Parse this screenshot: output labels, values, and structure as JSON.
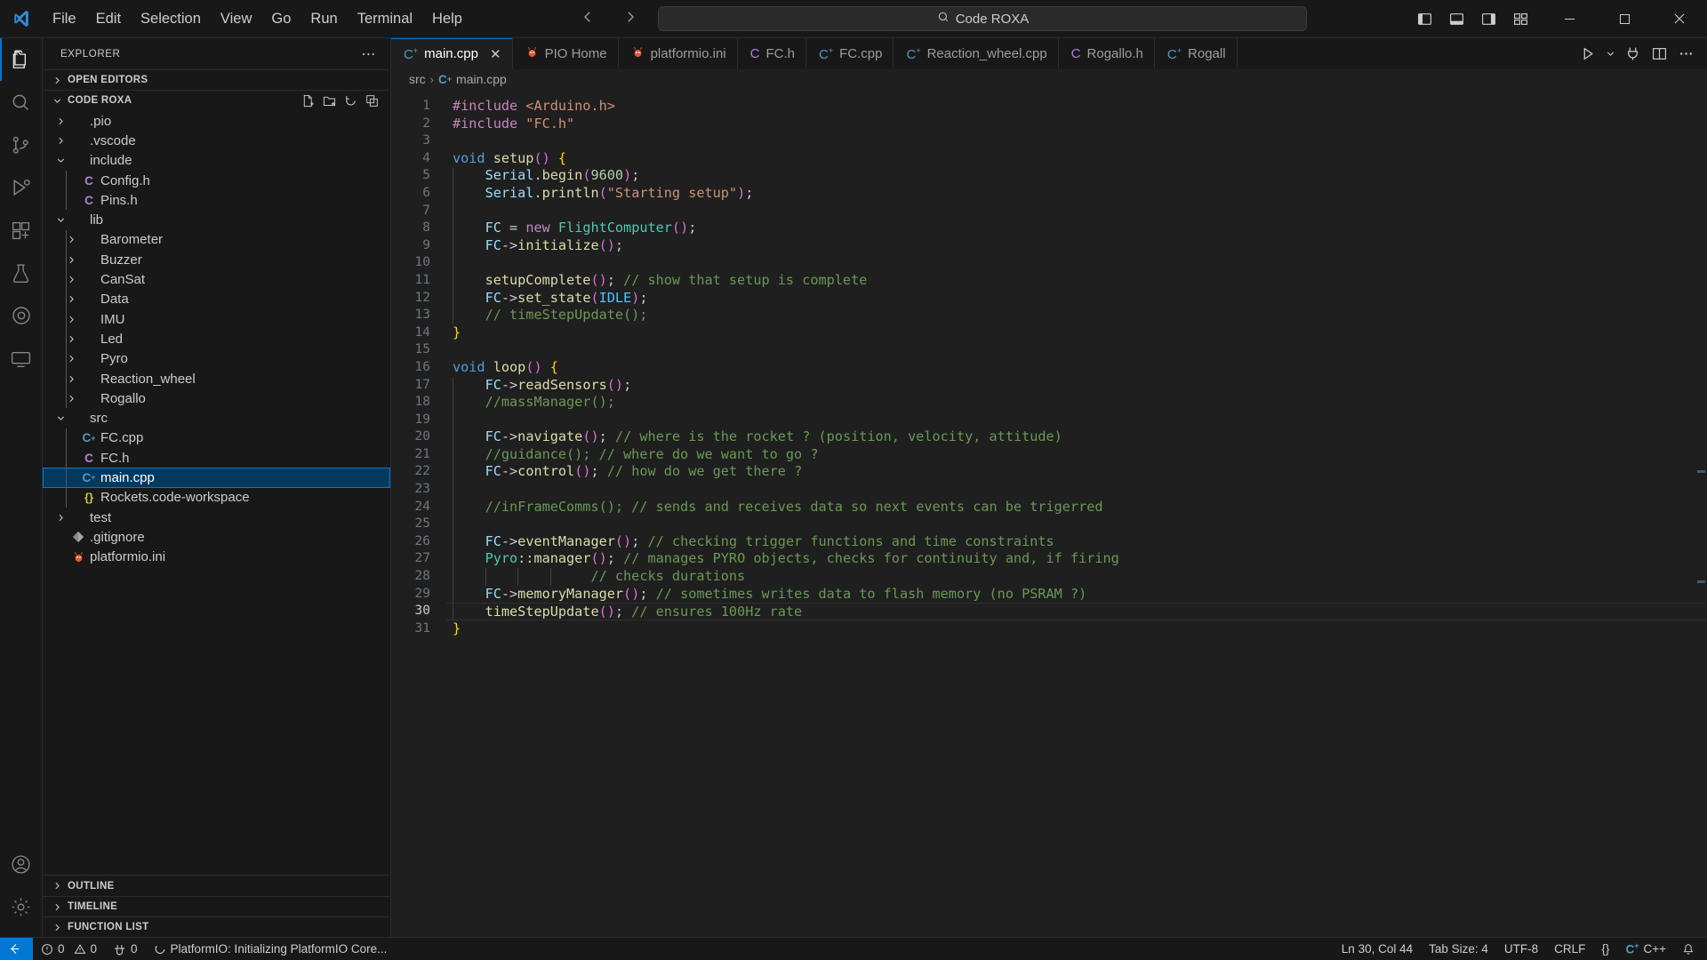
{
  "window": {
    "app": "Visual Studio Code",
    "command_center_text": "Code ROXA",
    "search_icon": "search-icon"
  },
  "menu": {
    "items": [
      {
        "label": "File"
      },
      {
        "label": "Edit"
      },
      {
        "label": "Selection"
      },
      {
        "label": "View"
      },
      {
        "label": "Go"
      },
      {
        "label": "Run"
      },
      {
        "label": "Terminal"
      },
      {
        "label": "Help"
      }
    ]
  },
  "window_controls": {
    "minimize": "─",
    "maximize": "☐",
    "close": "✕"
  },
  "layout_toggles": [
    {
      "name": "toggle-primary-sidebar-icon"
    },
    {
      "name": "toggle-panel-icon"
    },
    {
      "name": "toggle-secondary-sidebar-icon"
    },
    {
      "name": "customize-layout-icon"
    }
  ],
  "activitybar": {
    "items": [
      {
        "name": "explorer",
        "active": true
      },
      {
        "name": "search",
        "active": false
      },
      {
        "name": "source-control",
        "active": false
      },
      {
        "name": "run-and-debug",
        "active": false
      },
      {
        "name": "extensions",
        "active": false
      },
      {
        "name": "testing",
        "active": false
      },
      {
        "name": "platformio",
        "active": false
      },
      {
        "name": "remote-explorer",
        "active": false
      }
    ],
    "bottom": [
      {
        "name": "accounts"
      },
      {
        "name": "manage-settings"
      }
    ]
  },
  "sidebar": {
    "title": "EXPLORER",
    "more_actions": "⋯",
    "sections": [
      {
        "label": "OPEN EDITORS",
        "expanded": false
      },
      {
        "label": "CODE ROXA",
        "expanded": true
      }
    ],
    "folder_actions": [
      {
        "name": "new-file-icon"
      },
      {
        "name": "new-folder-icon"
      },
      {
        "name": "refresh-explorer-icon"
      },
      {
        "name": "collapse-folders-icon"
      }
    ],
    "tree": [
      {
        "label": ".pio",
        "type": "folder",
        "depth": 1,
        "expanded": false
      },
      {
        "label": ".vscode",
        "type": "folder",
        "depth": 1,
        "expanded": false
      },
      {
        "label": "include",
        "type": "folder",
        "depth": 1,
        "expanded": true
      },
      {
        "label": "Config.h",
        "type": "h",
        "depth": 2
      },
      {
        "label": "Pins.h",
        "type": "h",
        "depth": 2
      },
      {
        "label": "lib",
        "type": "folder",
        "depth": 1,
        "expanded": true
      },
      {
        "label": "Barometer",
        "type": "folder",
        "depth": 2,
        "expanded": false
      },
      {
        "label": "Buzzer",
        "type": "folder",
        "depth": 2,
        "expanded": false
      },
      {
        "label": "CanSat",
        "type": "folder",
        "depth": 2,
        "expanded": false
      },
      {
        "label": "Data",
        "type": "folder",
        "depth": 2,
        "expanded": false
      },
      {
        "label": "IMU",
        "type": "folder",
        "depth": 2,
        "expanded": false
      },
      {
        "label": "Led",
        "type": "folder",
        "depth": 2,
        "expanded": false
      },
      {
        "label": "Pyro",
        "type": "folder",
        "depth": 2,
        "expanded": false
      },
      {
        "label": "Reaction_wheel",
        "type": "folder",
        "depth": 2,
        "expanded": false
      },
      {
        "label": "Rogallo",
        "type": "folder",
        "depth": 2,
        "expanded": false
      },
      {
        "label": "src",
        "type": "folder",
        "depth": 1,
        "expanded": true
      },
      {
        "label": "FC.cpp",
        "type": "cpp",
        "depth": 2
      },
      {
        "label": "FC.h",
        "type": "h",
        "depth": 2
      },
      {
        "label": "main.cpp",
        "type": "cpp",
        "depth": 2,
        "selected": true
      },
      {
        "label": "Rockets.code-workspace",
        "type": "json",
        "depth": 2
      },
      {
        "label": "test",
        "type": "folder",
        "depth": 1,
        "expanded": false
      },
      {
        "label": ".gitignore",
        "type": "git",
        "depth": 1
      },
      {
        "label": "platformio.ini",
        "type": "pio",
        "depth": 1
      }
    ],
    "bottom_sections": [
      {
        "label": "OUTLINE"
      },
      {
        "label": "TIMELINE"
      },
      {
        "label": "FUNCTION LIST"
      }
    ]
  },
  "editor": {
    "tabs": [
      {
        "label": "main.cpp",
        "icon": "cpp",
        "active": true,
        "closable": true
      },
      {
        "label": "PIO Home",
        "icon": "pio",
        "active": false
      },
      {
        "label": "platformio.ini",
        "icon": "pio",
        "active": false
      },
      {
        "label": "FC.h",
        "icon": "h",
        "active": false
      },
      {
        "label": "FC.cpp",
        "icon": "cpp",
        "active": false
      },
      {
        "label": "Reaction_wheel.cpp",
        "icon": "cpp",
        "active": false
      },
      {
        "label": "Rogallo.h",
        "icon": "h",
        "active": false
      },
      {
        "label": "Rogall",
        "icon": "cpp",
        "active": false
      }
    ],
    "tab_close_glyph": "✕",
    "actions": [
      {
        "name": "run-code-button"
      },
      {
        "name": "run-options-chevron-icon"
      },
      {
        "name": "serial-monitor-icon"
      },
      {
        "name": "split-editor-right-icon"
      },
      {
        "name": "editor-more-actions-icon"
      }
    ],
    "breadcrumb": [
      "src",
      "main.cpp"
    ],
    "breadcrumb_separator": "›",
    "current_line": 30,
    "lines": [
      {
        "n": 1,
        "tokens": [
          {
            "t": "#include ",
            "c": "t-pre"
          },
          {
            "t": "<Arduino.h>",
            "c": "t-str"
          }
        ]
      },
      {
        "n": 2,
        "tokens": [
          {
            "t": "#include ",
            "c": "t-pre"
          },
          {
            "t": "\"FC.h\"",
            "c": "t-str"
          }
        ]
      },
      {
        "n": 3,
        "tokens": []
      },
      {
        "n": 4,
        "tokens": [
          {
            "t": "void",
            "c": "t-kw"
          },
          {
            "t": " ",
            "c": "t-op"
          },
          {
            "t": "setup",
            "c": "t-fn"
          },
          {
            "t": "()",
            "c": "t-brk2"
          },
          {
            "t": " ",
            "c": "t-op"
          },
          {
            "t": "{",
            "c": "t-brk1"
          }
        ]
      },
      {
        "n": 5,
        "indent": 1,
        "tokens": [
          {
            "t": "    ",
            "c": "t-op"
          },
          {
            "t": "Serial",
            "c": "t-var"
          },
          {
            "t": ".",
            "c": "t-op"
          },
          {
            "t": "begin",
            "c": "t-fn"
          },
          {
            "t": "(",
            "c": "t-brk2"
          },
          {
            "t": "9600",
            "c": "t-num"
          },
          {
            "t": ")",
            "c": "t-brk2"
          },
          {
            "t": ";",
            "c": "t-op"
          }
        ]
      },
      {
        "n": 6,
        "indent": 1,
        "tokens": [
          {
            "t": "    ",
            "c": "t-op"
          },
          {
            "t": "Serial",
            "c": "t-var"
          },
          {
            "t": ".",
            "c": "t-op"
          },
          {
            "t": "println",
            "c": "t-fn"
          },
          {
            "t": "(",
            "c": "t-brk2"
          },
          {
            "t": "\"Starting setup\"",
            "c": "t-str"
          },
          {
            "t": ")",
            "c": "t-brk2"
          },
          {
            "t": ";",
            "c": "t-op"
          }
        ]
      },
      {
        "n": 7,
        "indent": 1,
        "tokens": []
      },
      {
        "n": 8,
        "indent": 1,
        "tokens": [
          {
            "t": "    ",
            "c": "t-op"
          },
          {
            "t": "FC",
            "c": "t-var"
          },
          {
            "t": " = ",
            "c": "t-op"
          },
          {
            "t": "new",
            "c": "t-pre"
          },
          {
            "t": " ",
            "c": "t-op"
          },
          {
            "t": "FlightComputer",
            "c": "t-cls"
          },
          {
            "t": "()",
            "c": "t-brk2"
          },
          {
            "t": ";",
            "c": "t-op"
          }
        ]
      },
      {
        "n": 9,
        "indent": 1,
        "tokens": [
          {
            "t": "    ",
            "c": "t-op"
          },
          {
            "t": "FC",
            "c": "t-var"
          },
          {
            "t": "->",
            "c": "t-op"
          },
          {
            "t": "initialize",
            "c": "t-fn"
          },
          {
            "t": "()",
            "c": "t-brk2"
          },
          {
            "t": ";",
            "c": "t-op"
          }
        ]
      },
      {
        "n": 10,
        "indent": 1,
        "tokens": []
      },
      {
        "n": 11,
        "indent": 1,
        "tokens": [
          {
            "t": "    ",
            "c": "t-op"
          },
          {
            "t": "setupComplete",
            "c": "t-fn"
          },
          {
            "t": "()",
            "c": "t-brk2"
          },
          {
            "t": "; ",
            "c": "t-op"
          },
          {
            "t": "// show that setup is complete",
            "c": "t-cmt"
          }
        ]
      },
      {
        "n": 12,
        "indent": 1,
        "tokens": [
          {
            "t": "    ",
            "c": "t-op"
          },
          {
            "t": "FC",
            "c": "t-var"
          },
          {
            "t": "->",
            "c": "t-op"
          },
          {
            "t": "set_state",
            "c": "t-fn"
          },
          {
            "t": "(",
            "c": "t-brk2"
          },
          {
            "t": "IDLE",
            "c": "t-cnst"
          },
          {
            "t": ")",
            "c": "t-brk2"
          },
          {
            "t": ";",
            "c": "t-op"
          }
        ]
      },
      {
        "n": 13,
        "indent": 1,
        "tokens": [
          {
            "t": "    ",
            "c": "t-op"
          },
          {
            "t": "// timeStepUpdate();",
            "c": "t-cmt"
          }
        ]
      },
      {
        "n": 14,
        "tokens": [
          {
            "t": "}",
            "c": "t-brk1"
          }
        ]
      },
      {
        "n": 15,
        "tokens": []
      },
      {
        "n": 16,
        "tokens": [
          {
            "t": "void",
            "c": "t-kw"
          },
          {
            "t": " ",
            "c": "t-op"
          },
          {
            "t": "loop",
            "c": "t-fn"
          },
          {
            "t": "()",
            "c": "t-brk2"
          },
          {
            "t": " ",
            "c": "t-op"
          },
          {
            "t": "{",
            "c": "t-brk1"
          }
        ]
      },
      {
        "n": 17,
        "indent": 1,
        "tokens": [
          {
            "t": "    ",
            "c": "t-op"
          },
          {
            "t": "FC",
            "c": "t-var"
          },
          {
            "t": "->",
            "c": "t-op"
          },
          {
            "t": "readSensors",
            "c": "t-fn"
          },
          {
            "t": "()",
            "c": "t-brk2"
          },
          {
            "t": ";",
            "c": "t-op"
          }
        ]
      },
      {
        "n": 18,
        "indent": 1,
        "tokens": [
          {
            "t": "    ",
            "c": "t-op"
          },
          {
            "t": "//massManager();",
            "c": "t-cmt"
          }
        ]
      },
      {
        "n": 19,
        "indent": 1,
        "tokens": []
      },
      {
        "n": 20,
        "indent": 1,
        "tokens": [
          {
            "t": "    ",
            "c": "t-op"
          },
          {
            "t": "FC",
            "c": "t-var"
          },
          {
            "t": "->",
            "c": "t-op"
          },
          {
            "t": "navigate",
            "c": "t-fn"
          },
          {
            "t": "()",
            "c": "t-brk2"
          },
          {
            "t": "; ",
            "c": "t-op"
          },
          {
            "t": "// where is the rocket ? (position, velocity, attitude)",
            "c": "t-cmt"
          }
        ]
      },
      {
        "n": 21,
        "indent": 1,
        "tokens": [
          {
            "t": "    ",
            "c": "t-op"
          },
          {
            "t": "//guidance(); // where do we want to go ?",
            "c": "t-cmt"
          }
        ]
      },
      {
        "n": 22,
        "indent": 1,
        "tokens": [
          {
            "t": "    ",
            "c": "t-op"
          },
          {
            "t": "FC",
            "c": "t-var"
          },
          {
            "t": "->",
            "c": "t-op"
          },
          {
            "t": "control",
            "c": "t-fn"
          },
          {
            "t": "()",
            "c": "t-brk2"
          },
          {
            "t": "; ",
            "c": "t-op"
          },
          {
            "t": "// how do we get there ?",
            "c": "t-cmt"
          }
        ]
      },
      {
        "n": 23,
        "indent": 1,
        "tokens": []
      },
      {
        "n": 24,
        "indent": 1,
        "tokens": [
          {
            "t": "    ",
            "c": "t-op"
          },
          {
            "t": "//inFrameComms(); // sends and receives data so next events can be trigerred",
            "c": "t-cmt"
          }
        ]
      },
      {
        "n": 25,
        "indent": 1,
        "tokens": []
      },
      {
        "n": 26,
        "indent": 1,
        "tokens": [
          {
            "t": "    ",
            "c": "t-op"
          },
          {
            "t": "FC",
            "c": "t-var"
          },
          {
            "t": "->",
            "c": "t-op"
          },
          {
            "t": "eventManager",
            "c": "t-fn"
          },
          {
            "t": "()",
            "c": "t-brk2"
          },
          {
            "t": "; ",
            "c": "t-op"
          },
          {
            "t": "// checking trigger functions and time constraints",
            "c": "t-cmt"
          }
        ]
      },
      {
        "n": 27,
        "indent": 1,
        "tokens": [
          {
            "t": "    ",
            "c": "t-op"
          },
          {
            "t": "Pyro",
            "c": "t-cls"
          },
          {
            "t": "::",
            "c": "t-op"
          },
          {
            "t": "manager",
            "c": "t-fn"
          },
          {
            "t": "()",
            "c": "t-brk2"
          },
          {
            "t": "; ",
            "c": "t-op"
          },
          {
            "t": "// manages PYRO objects, checks for continuity and, if firing",
            "c": "t-cmt"
          }
        ]
      },
      {
        "n": 28,
        "indent": 4,
        "tokens": [
          {
            "t": "                 ",
            "c": "t-op"
          },
          {
            "t": "// checks durations",
            "c": "t-cmt"
          }
        ]
      },
      {
        "n": 29,
        "indent": 1,
        "tokens": [
          {
            "t": "    ",
            "c": "t-op"
          },
          {
            "t": "FC",
            "c": "t-var"
          },
          {
            "t": "->",
            "c": "t-op"
          },
          {
            "t": "memoryManager",
            "c": "t-fn"
          },
          {
            "t": "()",
            "c": "t-brk2"
          },
          {
            "t": "; ",
            "c": "t-op"
          },
          {
            "t": "// sometimes writes data to flash memory (no PSRAM ?)",
            "c": "t-cmt"
          }
        ]
      },
      {
        "n": 30,
        "indent": 1,
        "current": true,
        "tokens": [
          {
            "t": "    ",
            "c": "t-op"
          },
          {
            "t": "timeStepUpdate",
            "c": "t-fn"
          },
          {
            "t": "()",
            "c": "t-brk2"
          },
          {
            "t": "; ",
            "c": "t-op"
          },
          {
            "t": "// ensures 100Hz rate",
            "c": "t-cmt"
          }
        ]
      },
      {
        "n": 31,
        "tokens": [
          {
            "t": "}",
            "c": "t-brk1"
          }
        ]
      }
    ]
  },
  "statusbar": {
    "remote_label": "",
    "errors": "0",
    "warnings": "0",
    "ports": "0",
    "task_text": "PlatformIO: Initializing PlatformIO Core...",
    "cursor": "Ln 30, Col 44",
    "tab_size": "Tab Size: 4",
    "encoding": "UTF-8",
    "eol": "CRLF",
    "language": "C++",
    "braces": "{}",
    "bell": "bell-icon"
  },
  "colors": {
    "accent": "#0078d4",
    "selection": "#04395e",
    "bg_dark": "#181818",
    "bg_editor": "#1f1f1f",
    "pio_orange": "#f0792a"
  }
}
